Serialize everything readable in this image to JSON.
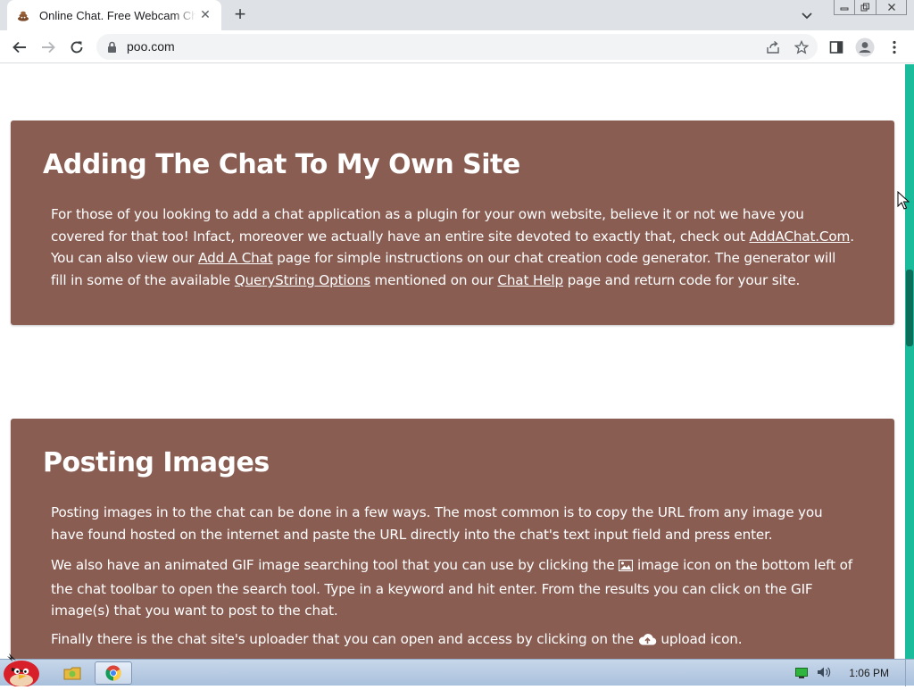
{
  "browser": {
    "tab": {
      "title": "Online Chat. Free Webcam Chat",
      "favicon": "poo-favicon-icon"
    },
    "new_tab_label": "+",
    "address": {
      "url": "poo.com"
    }
  },
  "page": {
    "section1": {
      "heading": "Adding The Chat To My Own Site",
      "body": {
        "t1": "For those of you looking to add a chat application as a plugin for your own website, believe it or not we have you covered for that too! Infact, moreover we actually have an entire site devoted to exactly that, check out ",
        "link1": "AddAChat.Com",
        "t2": ". You can also view our ",
        "link2": "Add A Chat",
        "t3": " page for simple instructions on our chat creation code generator. The generator will fill in some of the available ",
        "link3": "QueryString Options",
        "t4": " mentioned on our ",
        "link4": "Chat Help",
        "t5": " page and return code for your site."
      }
    },
    "section2": {
      "heading": "Posting Images",
      "p1": "Posting images in to the chat can be done in a few ways. The most common is to copy the URL from any image you have found hosted on the internet and paste the URL directly into the chat's text input field and press enter.",
      "p2_a": "We also have an animated GIF image searching tool that you can use by clicking the ",
      "p2_b": " image icon on the bottom left of the chat toolbar to open the search tool. Type in a keyword and hit enter. From the results you can click on the GIF image(s) that you want to post to the chat.",
      "p3_a": "Finally there is the chat site's uploader that you can open and access by clicking on the ",
      "p3_b": " upload icon."
    }
  },
  "taskbar": {
    "clock": "1:06 PM"
  },
  "colors": {
    "card_bg": "#8a5d53",
    "scrollbar": "#1abc9c"
  }
}
